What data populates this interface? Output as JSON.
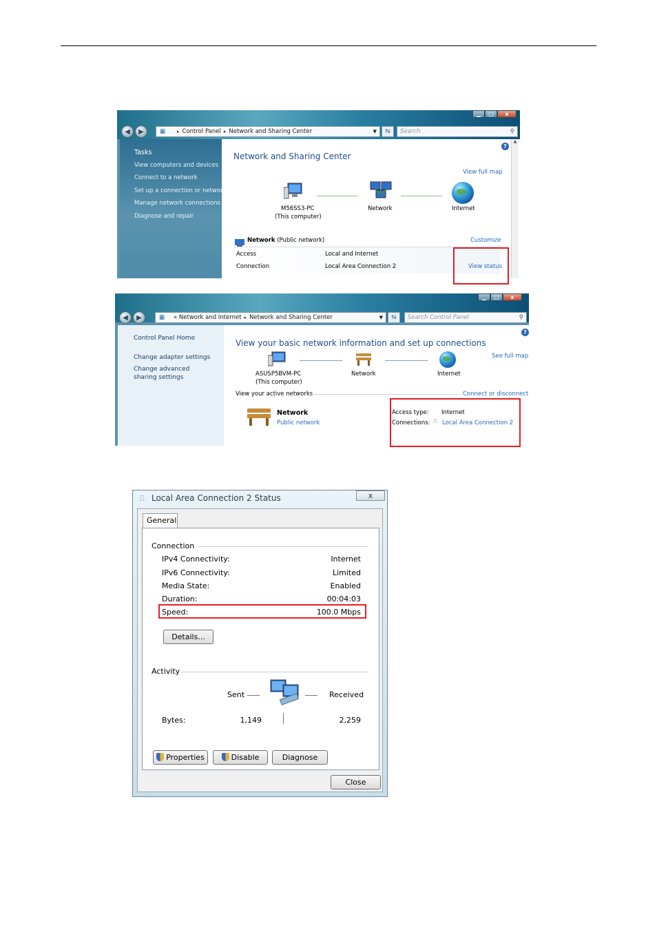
{
  "win1": {
    "address": [
      "Control Panel",
      "Network and Sharing Center"
    ],
    "search_placeholder": "Search",
    "controls": {
      "minimize": "▁",
      "maximize": "□",
      "close": "x"
    },
    "sidebar": {
      "title": "Tasks",
      "items": [
        "View computers and devices",
        "Connect to a network",
        "Set up a connection or network",
        "Manage network connections",
        "Diagnose and repair"
      ]
    },
    "heading": "Network and Sharing Center",
    "view_full_map": "View full map",
    "nodes": {
      "computer": "M56SS3-PC",
      "computer_sub": "(This computer)",
      "network": "Network",
      "internet": "Internet"
    },
    "network_name": "Network",
    "network_type": "(Public network)",
    "customize": "Customize",
    "rows": [
      {
        "label": "Access",
        "value": "Local and Internet"
      },
      {
        "label": "Connection",
        "value": "Local Area Connection 2"
      }
    ],
    "view_status": "View status"
  },
  "win2": {
    "address": [
      "Network and Internet",
      "Network and Sharing Center"
    ],
    "address_prefix": "«",
    "search_placeholder": "Search Control Panel",
    "controls": {
      "minimize": "▁",
      "maximize": "□",
      "close": "x"
    },
    "sidebar": {
      "home": "Control Panel Home",
      "items": [
        "Change adapter settings",
        "Change advanced sharing settings"
      ]
    },
    "heading": "View your basic network information and set up connections",
    "see_full_map": "See full map",
    "nodes": {
      "computer": "ASUSP5BVM-PC",
      "computer_sub": "(This computer)",
      "network": "Network",
      "internet": "Internet"
    },
    "active_networks": "View your active networks",
    "connect_disconnect": "Connect or disconnect",
    "network_name": "Network",
    "network_type": "Public network",
    "access_type_label": "Access type:",
    "access_type_value": "Internet",
    "connections_label": "Connections:",
    "connections_value": "Local Area Connection 2"
  },
  "dialog": {
    "title": "Local Area Connection 2 Status",
    "close_x": "x",
    "tab": "General",
    "connection_group": "Connection",
    "connection_rows": [
      {
        "label": "IPv4 Connectivity:",
        "value": "Internet"
      },
      {
        "label": "IPv6 Connectivity:",
        "value": "Limited"
      },
      {
        "label": "Media State:",
        "value": "Enabled"
      },
      {
        "label": "Duration:",
        "value": "00:04:03"
      },
      {
        "label": "Speed:",
        "value": "100.0 Mbps"
      }
    ],
    "details_button": "Details...",
    "activity_group": "Activity",
    "sent_label": "Sent",
    "received_label": "Received",
    "bytes_label": "Bytes:",
    "bytes_sent": "1,149",
    "bytes_received": "2,259",
    "properties_button": "Properties",
    "disable_button": "Disable",
    "diagnose_button": "Diagnose",
    "close_button": "Close"
  }
}
